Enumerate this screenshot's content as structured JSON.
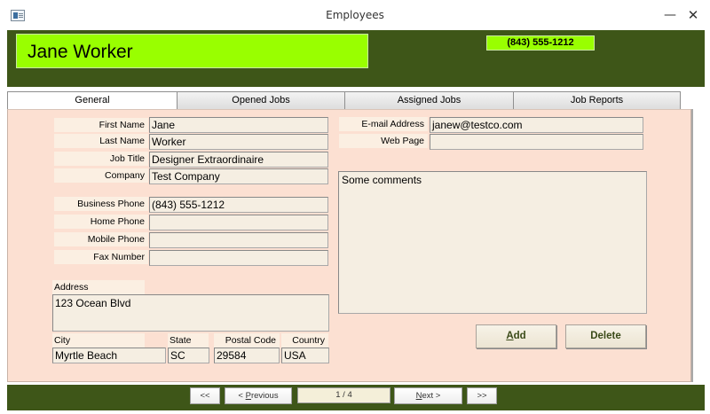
{
  "window": {
    "title": "Employees",
    "minimize_glyph": "—",
    "close_glyph": "✕",
    "icon": "form-icon"
  },
  "header": {
    "full_name": "Jane Worker",
    "phone": "(843) 555-1212",
    "bg_color": "#3e5618",
    "accent_color": "#99ff00"
  },
  "tabs": [
    {
      "label": "General",
      "active": true
    },
    {
      "label": "Opened Jobs",
      "active": false
    },
    {
      "label": "Assigned Jobs",
      "active": false
    },
    {
      "label": "Job Reports",
      "active": false
    }
  ],
  "form": {
    "first_name": {
      "label": "First Name",
      "value": "Jane"
    },
    "last_name": {
      "label": "Last Name",
      "value": "Worker"
    },
    "job_title": {
      "label": "Job Title",
      "value": "Designer Extraordinaire"
    },
    "company": {
      "label": "Company",
      "value": "Test Company"
    },
    "business_phone": {
      "label": "Business Phone",
      "value": "(843) 555-1212"
    },
    "home_phone": {
      "label": "Home Phone",
      "value": ""
    },
    "mobile_phone": {
      "label": "Mobile Phone",
      "value": ""
    },
    "fax_number": {
      "label": "Fax Number",
      "value": ""
    },
    "email": {
      "label": "E-mail Address",
      "value": "janew@testco.com"
    },
    "web_page": {
      "label": "Web Page",
      "value": ""
    },
    "address": {
      "label": "Address",
      "value": "123 Ocean Blvd"
    },
    "city": {
      "label": "City",
      "value": "Myrtle Beach"
    },
    "state": {
      "label": "State",
      "value": "SC"
    },
    "postal_code": {
      "label": "Postal Code",
      "value": "29584"
    },
    "country": {
      "label": "Country",
      "value": "USA"
    },
    "comments": {
      "value": "Some comments"
    }
  },
  "actions": {
    "add_accel": "A",
    "add_rest": "dd",
    "delete_label": "Delete"
  },
  "nav": {
    "first": "<<",
    "previous_accel": "P",
    "previous_prefix": "< ",
    "previous_rest": "revious",
    "record_indicator": "1 / 4",
    "next_accel": "N",
    "next_rest": "ext >",
    "last": ">>"
  }
}
